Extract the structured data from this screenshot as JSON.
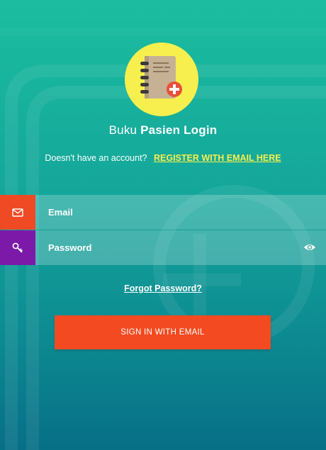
{
  "app": {
    "title_prefix": "Buku",
    "title_main": "Pasien Login",
    "logo_icon": "notebook-medical-icon"
  },
  "register": {
    "prompt": "Doesn't have an account?",
    "link_label": "REGISTER WITH EMAIL HERE"
  },
  "form": {
    "email": {
      "placeholder": "Email",
      "value": "",
      "icon": "envelope-icon"
    },
    "password": {
      "placeholder": "Password",
      "value": "",
      "icon": "key-icon",
      "toggle_icon": "eye-icon"
    }
  },
  "links": {
    "forgot_password": "Forgot Password?"
  },
  "actions": {
    "sign_in_label": "SIGN IN WITH EMAIL"
  },
  "colors": {
    "background_top": "#1bbd9f",
    "background_bottom": "#076f86",
    "logo_background": "#f7ef4d",
    "email_icon_background": "#f04a25",
    "password_icon_background": "#7c19a8",
    "link_accent": "#f7ef4d",
    "sign_in_button": "#f34a21"
  }
}
